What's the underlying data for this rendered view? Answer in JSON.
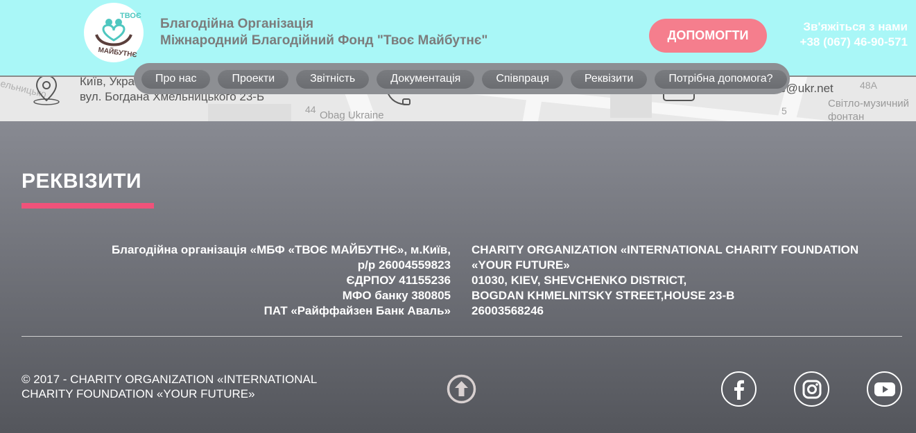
{
  "header": {
    "logo_text_top": "ТВОЄ",
    "logo_text_bottom": "МАЙБУТНЄ",
    "org_line1": "Благодійна Організація",
    "org_line2": "Міжнародний Благодійний Фонд \"Твоє Майбутнє\"",
    "help_button": "ДОПОМОГТИ",
    "contact_label": "Зв'яжіться з нами",
    "contact_phone": "+38 (067) 46-90-571"
  },
  "nav": {
    "items": [
      "Про нас",
      "Проекти",
      "Звітність",
      "Документація",
      "Співпраця",
      "Реквізити",
      "Потрібна допомога?"
    ]
  },
  "map": {
    "address_line1": "Київ, Укра",
    "address_line2": "вул. Богдана Хмельницького 23-Б",
    "email_fragment": "e@ukr.net",
    "street_label": "ельницько",
    "poi_label": "Obag Ukraine",
    "building_44": "44",
    "building_48a": "48А",
    "building_5": "5",
    "fountain_line1": "Світло-музичний",
    "fountain_line2": "фонтан"
  },
  "requisites": {
    "title": "РЕКВІЗИТИ",
    "left_lines": [
      "Благодійна організація «МБФ «ТВОЄ МАЙБУТНЄ», м.Київ,",
      "р/р 26004559823",
      "ЄДРПОУ 41155236",
      "МФО банку 380805",
      "ПАТ «Райффайзен Банк Аваль»"
    ],
    "right_lines": [
      "CHARITY ORGANIZATION «INTERNATIONAL CHARITY FOUNDATION «YOUR FUTURE»",
      "01030, KIEV, SHEVCHENKO DISTRICT,",
      "BOGDAN KHMELNITSKY STREET,HOUSE 23-B",
      "26003568246"
    ]
  },
  "footer": {
    "copyright_line1": "© 2017 - CHARITY ORGANIZATION «INTERNATIONAL",
    "copyright_line2": "CHARITY FOUNDATION «YOUR FUTURE»",
    "social": [
      "facebook-icon",
      "instagram-icon",
      "youtube-icon"
    ]
  },
  "colors": {
    "header_bg": "#a9f7f7",
    "help_button": "#f57e8d",
    "accent_underline": "#f0527a",
    "nav_bg": "#8d8f93"
  }
}
